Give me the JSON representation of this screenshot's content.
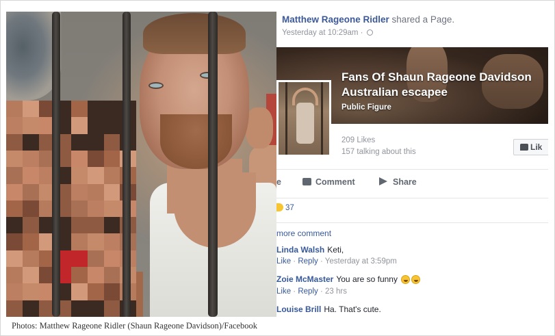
{
  "caption": "Photos: Matthew Rageone Ridler (Shaun Rageone Davidson)/Facebook",
  "post": {
    "author": "Matthew Rageone Ridler",
    "action": "shared a Page.",
    "time": "Yesterday at 10:29am",
    "time_separator": "·"
  },
  "page": {
    "name": "Fans Of Shaun Rageone Davidson Australian escapee",
    "category": "Public Figure",
    "likes": "209 Likes",
    "talking": "157 talking about this",
    "like_button": "Lik"
  },
  "actions": {
    "partial": "e",
    "comment": "Comment",
    "share": "Share"
  },
  "reactions": {
    "count": "37"
  },
  "comments": {
    "more": "more comment",
    "items": [
      {
        "name": "Linda Walsh",
        "text": "Keti,",
        "like": "Like",
        "reply": "Reply",
        "time": "Yesterday at 3:59pm"
      },
      {
        "name": "Zoie McMaster",
        "text": "You are so funny",
        "like": "Like",
        "reply": "Reply",
        "time": "23 hrs"
      },
      {
        "name": "Louise Brill",
        "text": "Ha. That's cute."
      }
    ]
  },
  "colors": {
    "facebook_blue": "#3b5998",
    "link_blue": "#365899",
    "meta_gray": "#90949c"
  },
  "icons": [
    "globe-icon",
    "thumbs-up-icon",
    "comment-icon",
    "share-icon",
    "laughing-emoji-icon"
  ]
}
